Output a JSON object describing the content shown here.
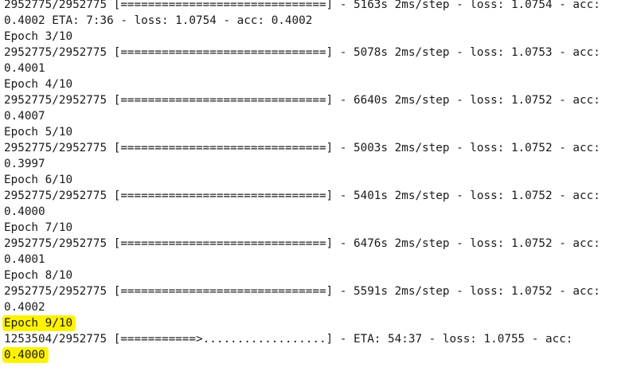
{
  "console": {
    "lines": [
      {
        "text": "2952775/2952775 [==============================] - 5163s 2ms/step - loss: 1.0754 - acc:",
        "highlight": false
      },
      {
        "text": "0.4002 ETA: 7:36 - loss: 1.0754 - acc: 0.4002",
        "highlight": false
      },
      {
        "text": "Epoch 3/10",
        "highlight": false
      },
      {
        "text": "2952775/2952775 [==============================] - 5078s 2ms/step - loss: 1.0753 - acc:",
        "highlight": false
      },
      {
        "text": "0.4001",
        "highlight": false
      },
      {
        "text": "Epoch 4/10",
        "highlight": false
      },
      {
        "text": "2952775/2952775 [==============================] - 6640s 2ms/step - loss: 1.0752 - acc:",
        "highlight": false
      },
      {
        "text": "0.4007",
        "highlight": false
      },
      {
        "text": "Epoch 5/10",
        "highlight": false
      },
      {
        "text": "2952775/2952775 [==============================] - 5003s 2ms/step - loss: 1.0752 - acc:",
        "highlight": false
      },
      {
        "text": "0.3997",
        "highlight": false
      },
      {
        "text": "Epoch 6/10",
        "highlight": false
      },
      {
        "text": "2952775/2952775 [==============================] - 5401s 2ms/step - loss: 1.0752 - acc:",
        "highlight": false
      },
      {
        "text": "0.4000",
        "highlight": false
      },
      {
        "text": "Epoch 7/10",
        "highlight": false
      },
      {
        "text": "2952775/2952775 [==============================] - 6476s 2ms/step - loss: 1.0752 - acc:",
        "highlight": false
      },
      {
        "text": "0.4001",
        "highlight": false
      },
      {
        "text": "Epoch 8/10",
        "highlight": false
      },
      {
        "text": "2952775/2952775 [==============================] - 5591s 2ms/step - loss: 1.0752 - acc:",
        "highlight": false
      },
      {
        "text": "0.4002",
        "highlight": false
      },
      {
        "text": "Epoch 9/10",
        "highlight": true
      },
      {
        "text": "1253504/2952775 [===========>..................] - ETA: 54:37 - loss: 1.0755 - acc:",
        "highlight": false
      },
      {
        "text": "0.4000",
        "highlight": true
      }
    ],
    "highlight_color": "#fff200",
    "text_color": "#1a1a1a"
  }
}
